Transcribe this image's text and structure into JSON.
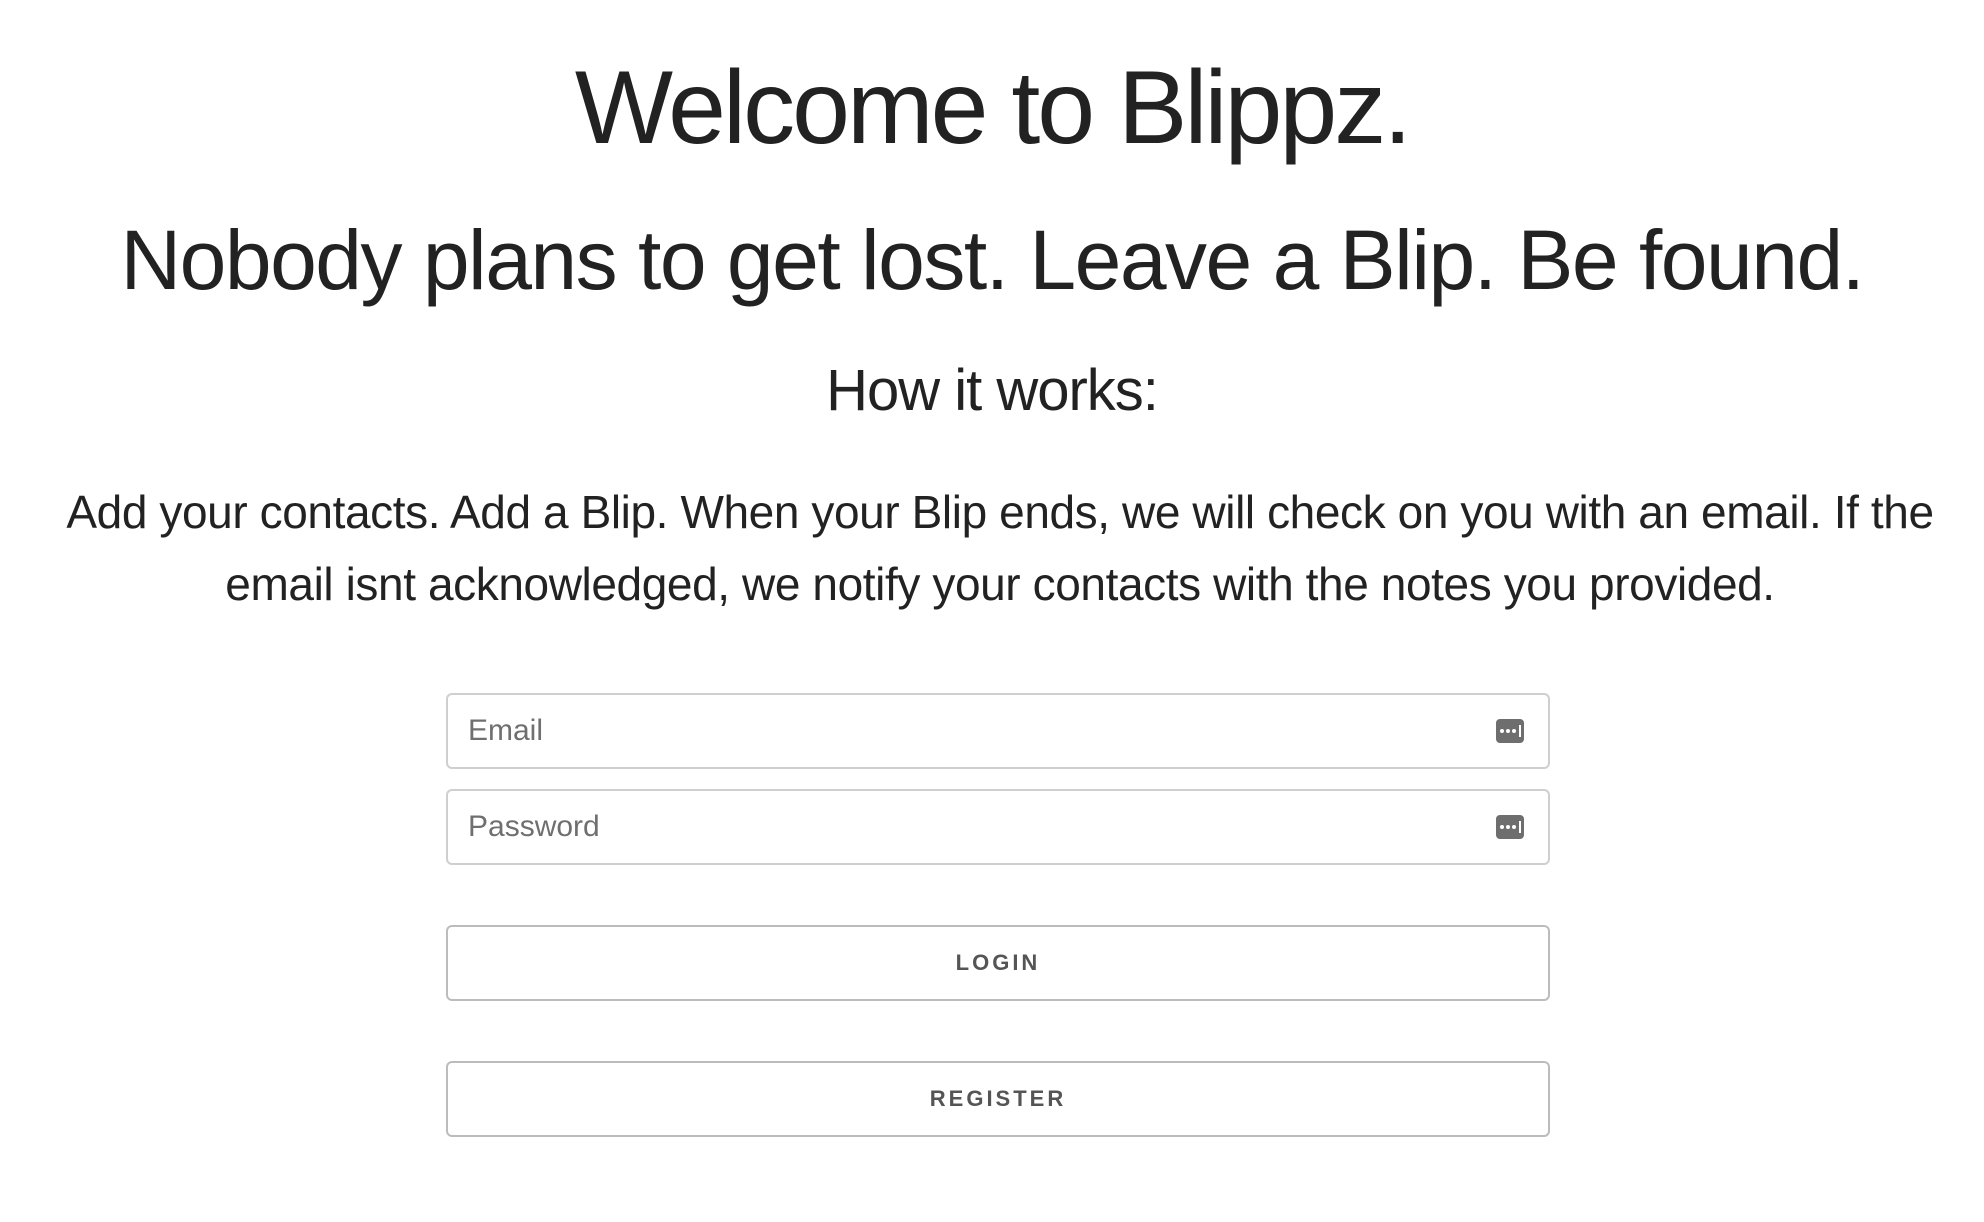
{
  "header": {
    "title": "Welcome to Blippz.",
    "tagline": "Nobody plans to get lost. Leave a Blip. Be found.",
    "how_heading": "How it works:",
    "description": "Add your contacts. Add a Blip. When your Blip ends, we will check on you with an email. If the email isnt acknowledged, we notify your contacts with the notes you provided."
  },
  "login_form": {
    "email": {
      "placeholder": "Email",
      "value": "",
      "icon": "autofill-key-icon"
    },
    "password": {
      "placeholder": "Password",
      "value": "",
      "icon": "autofill-key-icon"
    },
    "login_label": "Login",
    "register_label": "Register"
  },
  "colors": {
    "text": "#222222",
    "placeholder": "#6f6f6f",
    "border": "#cfcfcf",
    "button_text": "#555555",
    "icon": "#6e6e6e"
  }
}
